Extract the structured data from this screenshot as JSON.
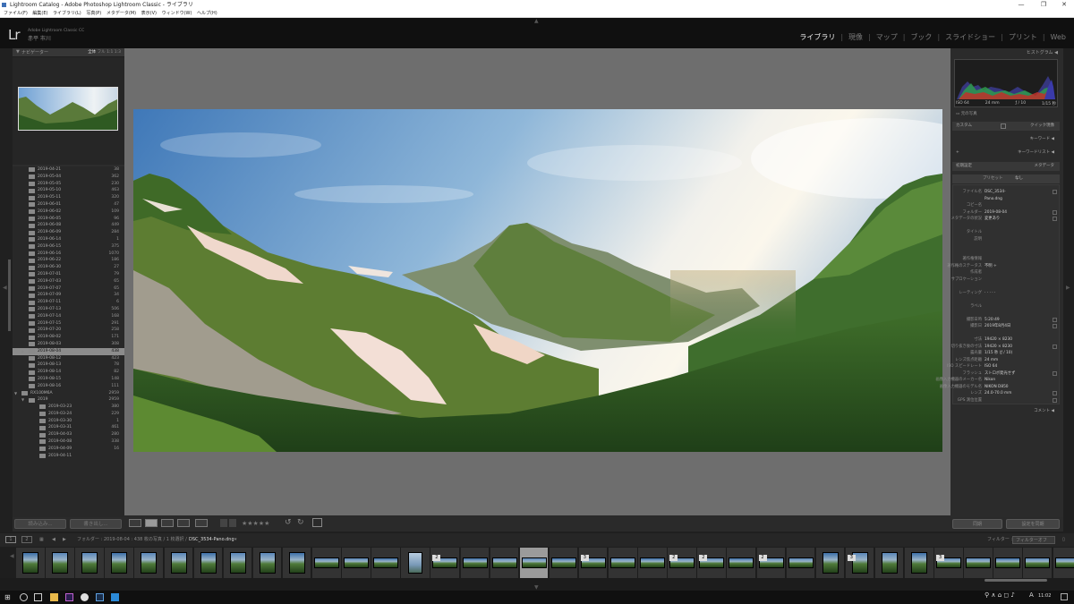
{
  "window": {
    "title": "Lightroom Catalog - Adobe Photoshop Lightroom Classic - ライブラリ",
    "controls": [
      "—",
      "❐",
      "✕"
    ]
  },
  "menu": [
    "ファイル(F)",
    "編集(E)",
    "ライブラリ(L)",
    "写真(P)",
    "メタデータ(M)",
    "表示(V)",
    "ウィンドウ(W)",
    "ヘルプ(H)"
  ],
  "identity": {
    "logo": "Lr",
    "app_name": "Adobe Lightroom Classic CC",
    "user": "赤平 市川"
  },
  "modules": [
    "ライブラリ",
    "現像",
    "マップ",
    "ブック",
    "スライドショー",
    "プリント",
    "Web"
  ],
  "active_module": "ライブラリ",
  "navigator": {
    "title": "ナビゲーター",
    "zoom_options": [
      "全体",
      "フル",
      "1:1",
      "1:3"
    ],
    "active_zoom": "全体"
  },
  "folders": [
    {
      "name": "2019-04-21",
      "count": "38",
      "indent": 2
    },
    {
      "name": "2019-05-04",
      "count": "362",
      "indent": 2
    },
    {
      "name": "2019-05-05",
      "count": "230",
      "indent": 2
    },
    {
      "name": "2019-05-10",
      "count": "463",
      "indent": 2
    },
    {
      "name": "2019-05-11",
      "count": "320",
      "indent": 2
    },
    {
      "name": "2019-06-01",
      "count": "47",
      "indent": 2
    },
    {
      "name": "2019-06-02",
      "count": "109",
      "indent": 2
    },
    {
      "name": "2019-06-05",
      "count": "96",
      "indent": 2
    },
    {
      "name": "2019-06-08",
      "count": "449",
      "indent": 2
    },
    {
      "name": "2019-06-09",
      "count": "284",
      "indent": 2
    },
    {
      "name": "2019-06-14",
      "count": "1",
      "indent": 2
    },
    {
      "name": "2019-06-15",
      "count": "375",
      "indent": 2
    },
    {
      "name": "2019-06-16",
      "count": "1070",
      "indent": 2
    },
    {
      "name": "2019-06-22",
      "count": "186",
      "indent": 2
    },
    {
      "name": "2019-06-30",
      "count": "27",
      "indent": 2
    },
    {
      "name": "2019-07-01",
      "count": "79",
      "indent": 2
    },
    {
      "name": "2019-07-03",
      "count": "65",
      "indent": 2
    },
    {
      "name": "2019-07-07",
      "count": "65",
      "indent": 2
    },
    {
      "name": "2019-07-09",
      "count": "34",
      "indent": 2
    },
    {
      "name": "2019-07-11",
      "count": "6",
      "indent": 2
    },
    {
      "name": "2019-07-13",
      "count": "506",
      "indent": 2
    },
    {
      "name": "2019-07-14",
      "count": "168",
      "indent": 2
    },
    {
      "name": "2019-07-15",
      "count": "291",
      "indent": 2
    },
    {
      "name": "2019-07-20",
      "count": "258",
      "indent": 2
    },
    {
      "name": "2019-08-02",
      "count": "171",
      "indent": 2
    },
    {
      "name": "2019-08-03",
      "count": "308",
      "indent": 2
    },
    {
      "name": "2019-08-04",
      "count": "438",
      "indent": 2,
      "selected": true
    },
    {
      "name": "2019-08-12",
      "count": "423",
      "indent": 2
    },
    {
      "name": "2019-08-13",
      "count": "78",
      "indent": 2
    },
    {
      "name": "2019-08-14",
      "count": "82",
      "indent": 2
    },
    {
      "name": "2019-08-15",
      "count": "148",
      "indent": 2
    },
    {
      "name": "2019-08-16",
      "count": "111",
      "indent": 2
    },
    {
      "name": "RX100M6A",
      "count": "2959",
      "indent": 1,
      "open": true
    },
    {
      "name": "2019",
      "count": "2959",
      "indent": 2,
      "open": true
    },
    {
      "name": "2019-03-23",
      "count": "380",
      "indent": 3
    },
    {
      "name": "2019-03-24",
      "count": "229",
      "indent": 3
    },
    {
      "name": "2019-03-30",
      "count": "1",
      "indent": 3
    },
    {
      "name": "2019-03-31",
      "count": "461",
      "indent": 3
    },
    {
      "name": "2019-04-03",
      "count": "280",
      "indent": 3
    },
    {
      "name": "2019-04-08",
      "count": "338",
      "indent": 3
    },
    {
      "name": "2019-04-09",
      "count": "16",
      "indent": 3
    },
    {
      "name": "2019-04-11",
      "count": "",
      "indent": 3
    }
  ],
  "left_buttons": {
    "import": "読み込み...",
    "export": "書き出し..."
  },
  "toolbar": {
    "stars": "★★★★★"
  },
  "right_panel": {
    "histogram_title": "ヒストグラム",
    "histo_info": {
      "iso": "ISO 64",
      "focal": "24 mm",
      "aperture": "ƒ / 10",
      "shutter": "1/15 秒"
    },
    "original_photo": "元の写真",
    "quick_develop": {
      "preset": "カスタム",
      "title": "クイック現像"
    },
    "keywording": "キーワード",
    "keyword_list": "キーワードリスト",
    "metadata": {
      "preset_set": "初期設定",
      "title": "メタデータ"
    },
    "preset_label": "プリセット",
    "preset_value": "なし",
    "comments": "コメント",
    "sync_button": "同期",
    "sync_settings_button": "設定を同期"
  },
  "metadata_rows": [
    {
      "k": "ファイル名",
      "v": "DSC_3534-",
      "b": true
    },
    {
      "k": "",
      "v": "Pano.dng"
    },
    {
      "k": "コピー名",
      "v": ""
    },
    {
      "k": "フォルダー",
      "v": "2019-08-04",
      "b": true
    },
    {
      "k": "メタデータの状況",
      "v": "変更あり",
      "b": true
    },
    {
      "k": "",
      "v": ""
    },
    {
      "k": "タイトル",
      "v": ""
    },
    {
      "k": "説明",
      "v": ""
    },
    {
      "k": "",
      "v": ""
    },
    {
      "k": "",
      "v": ""
    },
    {
      "k": "著作権情報",
      "v": ""
    },
    {
      "k": "著作権のステータス",
      "v": "不明 ÷"
    },
    {
      "k": "作成者",
      "v": ""
    },
    {
      "k": "サブロケーション",
      "v": ""
    },
    {
      "k": "",
      "v": ""
    },
    {
      "k": "レーティング",
      "v": "· · · · ·"
    },
    {
      "k": "",
      "v": ""
    },
    {
      "k": "ラベル",
      "v": ""
    },
    {
      "k": "",
      "v": ""
    },
    {
      "k": "撮影日時",
      "v": "5:20:49",
      "b": true
    },
    {
      "k": "撮影日",
      "v": "2019年8月4日",
      "b": true
    },
    {
      "k": "",
      "v": ""
    },
    {
      "k": "寸法",
      "v": "19420 × 8230"
    },
    {
      "k": "切り抜き後の寸法",
      "v": "19420 × 8230",
      "b": true
    },
    {
      "k": "露光量",
      "v": "1/15 秒 (ƒ / 10)"
    },
    {
      "k": "レンズ焦点距離",
      "v": "24 mm"
    },
    {
      "k": "ISO スピードレート",
      "v": "ISO 64"
    },
    {
      "k": "フラッシュ",
      "v": "ストロボ発光せず",
      "b": true
    },
    {
      "k": "画像入力機器のメーカー名",
      "v": "Nikon"
    },
    {
      "k": "画像入力機器のモデル名",
      "v": "NIKON D850"
    },
    {
      "k": "レンズ",
      "v": "24.0-70.0 mm",
      "b": true
    },
    {
      "k": "GPS 測位位置",
      "v": "",
      "b": true
    }
  ],
  "filmbar": {
    "path": "フォルダー : 2019-08-04 : 438 枚の写真 / 1 枚選択 /",
    "file": "DSC_3534-Pano.dng",
    "filter_label": "フィルター :",
    "filter_value": "フィルターオフ"
  },
  "thumbnails": [
    {
      "kind": "plain"
    },
    {
      "kind": "plain"
    },
    {
      "kind": "plain"
    },
    {
      "kind": "plain"
    },
    {
      "kind": "plain"
    },
    {
      "kind": "plain"
    },
    {
      "kind": "plain"
    },
    {
      "kind": "plain"
    },
    {
      "kind": "plain"
    },
    {
      "kind": "plain"
    },
    {
      "kind": "wide"
    },
    {
      "kind": "wide"
    },
    {
      "kind": "wide"
    },
    {
      "kind": "tall"
    },
    {
      "kind": "wide",
      "badge": "2"
    },
    {
      "kind": "wide"
    },
    {
      "kind": "wide"
    },
    {
      "kind": "wide",
      "selected": true
    },
    {
      "kind": "wide"
    },
    {
      "kind": "wide",
      "badge": "3"
    },
    {
      "kind": "wide"
    },
    {
      "kind": "wide"
    },
    {
      "kind": "wide",
      "badge": "2"
    },
    {
      "kind": "wide",
      "badge": "2"
    },
    {
      "kind": "wide"
    },
    {
      "kind": "wide",
      "badge": "2"
    },
    {
      "kind": "wide"
    },
    {
      "kind": "plain"
    },
    {
      "kind": "plain",
      "badge": "3"
    },
    {
      "kind": "plain"
    },
    {
      "kind": "plain"
    },
    {
      "kind": "wide",
      "badge": "3"
    },
    {
      "kind": "wide"
    },
    {
      "kind": "wide"
    },
    {
      "kind": "wide"
    },
    {
      "kind": "wide"
    }
  ],
  "taskbar": {
    "time": "11:02",
    "ime": "A"
  }
}
